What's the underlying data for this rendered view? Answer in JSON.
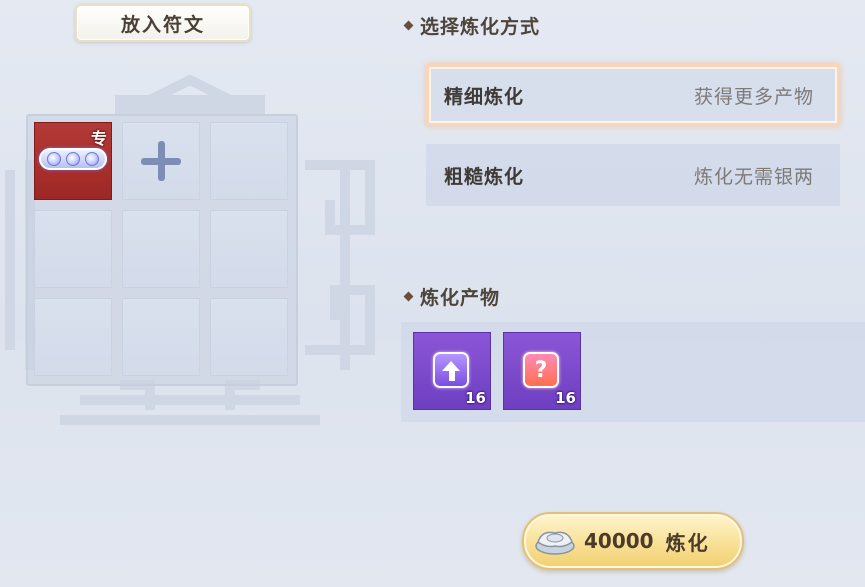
{
  "header": {
    "tab_label": "放入符文"
  },
  "rune_grid": {
    "slots": [
      {
        "type": "rune",
        "tag": "专",
        "gems": 3
      },
      {
        "type": "add"
      },
      {
        "type": "empty"
      },
      {
        "type": "empty"
      },
      {
        "type": "empty"
      },
      {
        "type": "empty"
      },
      {
        "type": "empty"
      },
      {
        "type": "empty"
      },
      {
        "type": "empty"
      }
    ]
  },
  "refine_method": {
    "title": "选择炼化方式",
    "options": [
      {
        "name": "精细炼化",
        "desc": "获得更多产物",
        "selected": true
      },
      {
        "name": "粗糙炼化",
        "desc": "炼化无需银两",
        "selected": false
      }
    ]
  },
  "products": {
    "title": "炼化产物",
    "items": [
      {
        "icon": "upgrade-arrow-icon",
        "qty": "16"
      },
      {
        "icon": "question-mark-icon",
        "qty": "16"
      }
    ]
  },
  "action": {
    "icon": "silver-ingot-icon",
    "cost": "40000",
    "label": "炼化"
  },
  "colors": {
    "selected_border": "#f6d7bd",
    "rune_slot": "#b23a36",
    "product_slot": "#7d4acb",
    "button_gold": "#f9e4a0"
  }
}
